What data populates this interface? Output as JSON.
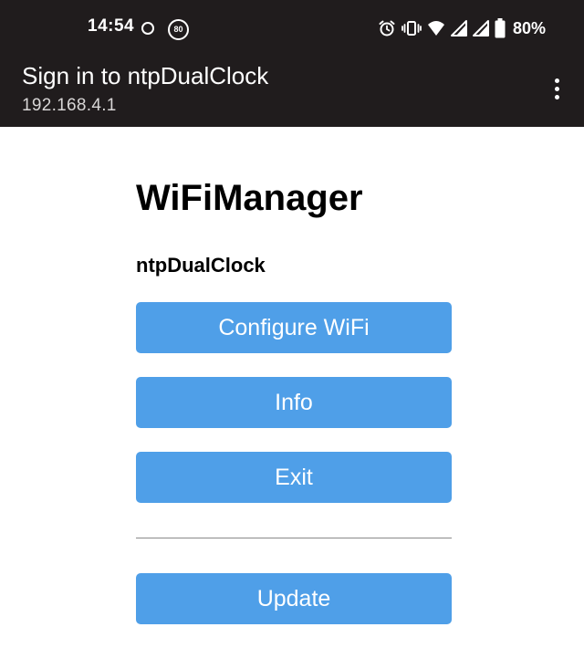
{
  "status_bar": {
    "time": "14:54",
    "notification_badge": "80",
    "battery_percent": "80%",
    "icons": [
      "ring-icon",
      "badge-80-icon",
      "alarm-icon",
      "vibrate-icon",
      "wifi-icon",
      "signal-icon",
      "signal-icon",
      "battery-icon"
    ]
  },
  "app_bar": {
    "title": "Sign in to ntpDualClock",
    "subtitle": "192.168.4.1",
    "menu_icon": "more-vert-icon"
  },
  "page": {
    "heading": "WiFiManager",
    "device_name": "ntpDualClock",
    "buttons": [
      {
        "label": "Configure WiFi"
      },
      {
        "label": "Info"
      },
      {
        "label": "Exit"
      },
      {
        "label": "Update"
      }
    ]
  },
  "colors": {
    "bar_background": "#201c1d",
    "button_background": "#4f9fe8",
    "button_text": "#ffffff",
    "page_background": "#ffffff"
  }
}
